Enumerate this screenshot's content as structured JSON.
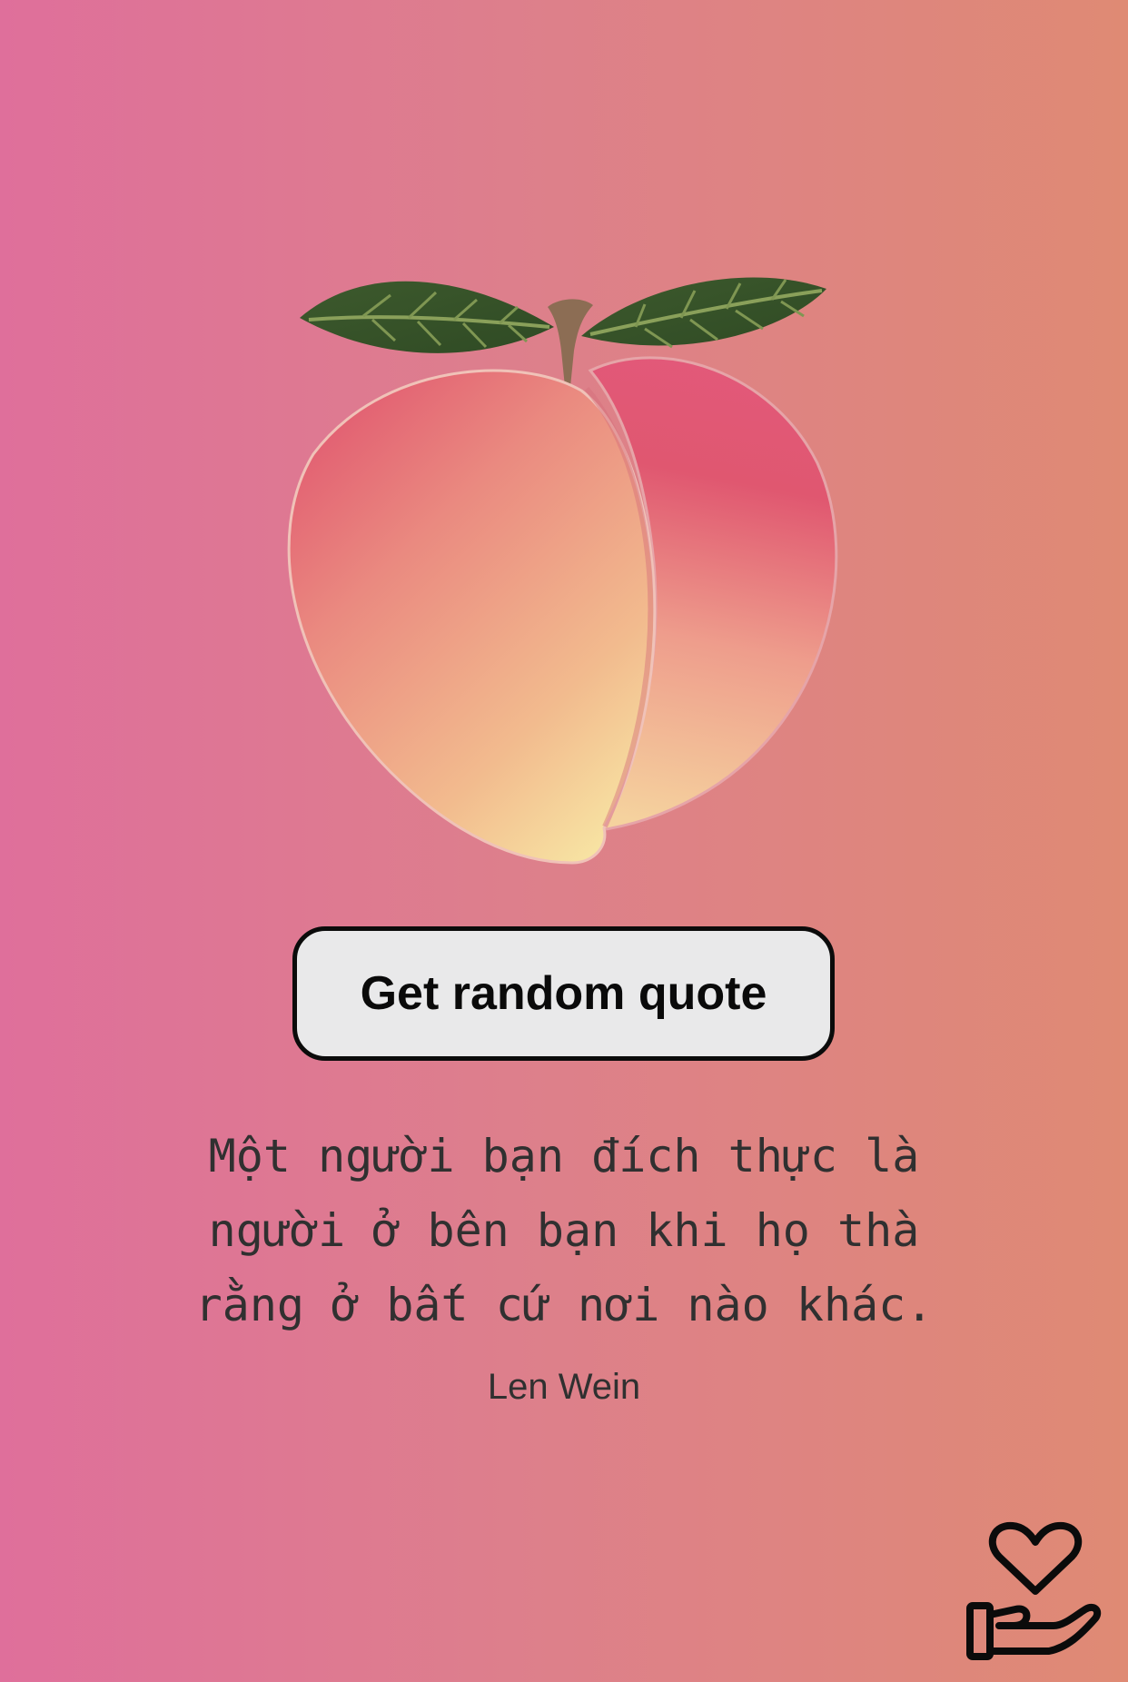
{
  "illustration": {
    "icon": "peach-icon",
    "colors": {
      "leaf": "#3e5a2e",
      "stem": "#8c6d54",
      "peach_top": "#e0546e",
      "peach_bottom": "#f7e0a0"
    }
  },
  "button": {
    "label": "Get random quote"
  },
  "quote": {
    "text": "Một người bạn đích thực là\nngười ở bên bạn khi họ thà\nrằng ở bất cứ nơi nào khác.",
    "author": "Len Wein"
  },
  "footer": {
    "donate_icon": "heart-hand-icon"
  },
  "colors": {
    "background_left": "#df6f9b",
    "background_right": "#df8a74",
    "button_bg": "#e9e9ea",
    "text": "#303030"
  }
}
